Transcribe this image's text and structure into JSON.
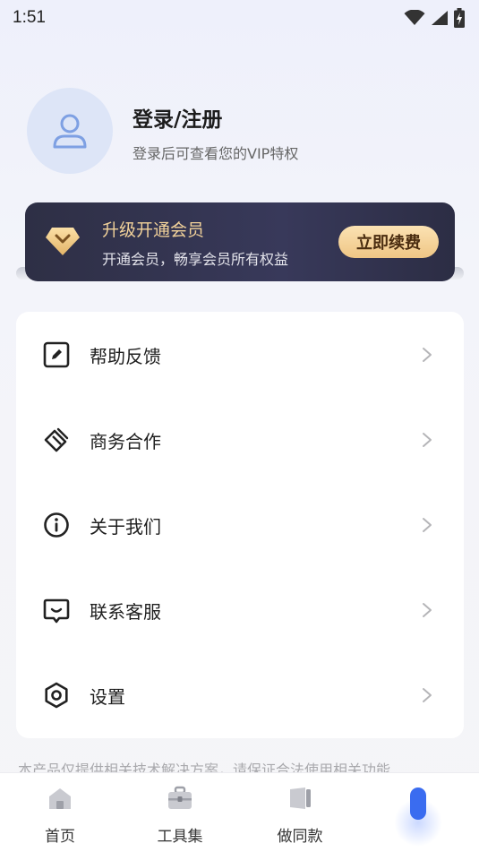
{
  "status_bar": {
    "time": "1:51",
    "icons": [
      "wifi-icon",
      "signal-icon",
      "battery-charging-icon"
    ]
  },
  "profile": {
    "avatar_icon": "user-icon",
    "title": "登录/注册",
    "subtitle": "登录后可查看您的VIP特权"
  },
  "vip": {
    "icon": "diamond-icon",
    "title": "升级开通会员",
    "subtitle": "开通会员，畅享会员所有权益",
    "button": "立即续费",
    "colors": {
      "card": "#2e2f45",
      "title": "#f2d29a",
      "button": "#f5d59c"
    }
  },
  "menu": {
    "items": [
      {
        "label": "帮助反馈",
        "icon": "edit-feedback-icon"
      },
      {
        "label": "商务合作",
        "icon": "handshake-icon"
      },
      {
        "label": "关于我们",
        "icon": "info-icon"
      },
      {
        "label": "联系客服",
        "icon": "chat-service-icon"
      },
      {
        "label": "设置",
        "icon": "settings-hexagon-icon"
      }
    ]
  },
  "disclaimer": "本产品仅提供相关技术解决方案，请保证合法使用相关功能",
  "tabbar": {
    "tabs": [
      {
        "label": "首页",
        "icon": "home-icon"
      },
      {
        "label": "工具集",
        "icon": "toolbox-icon"
      },
      {
        "label": "做同款",
        "icon": "template-icon"
      },
      {
        "label": "",
        "icon": "mine-icon",
        "active": true
      }
    ],
    "active_color": "#3a6cf0"
  }
}
